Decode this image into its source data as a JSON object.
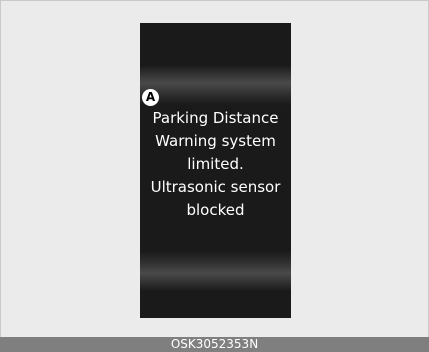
{
  "callout_marker": "A",
  "message_lines": [
    "Parking Distance",
    "Warning system",
    "limited.",
    "Ultrasonic sensor",
    "blocked"
  ],
  "figure_code": "OSK3052353N",
  "colors": {
    "display_background": "#1a1a1a",
    "text": "#ffffff",
    "caption_bar": "#7f7f7f"
  }
}
